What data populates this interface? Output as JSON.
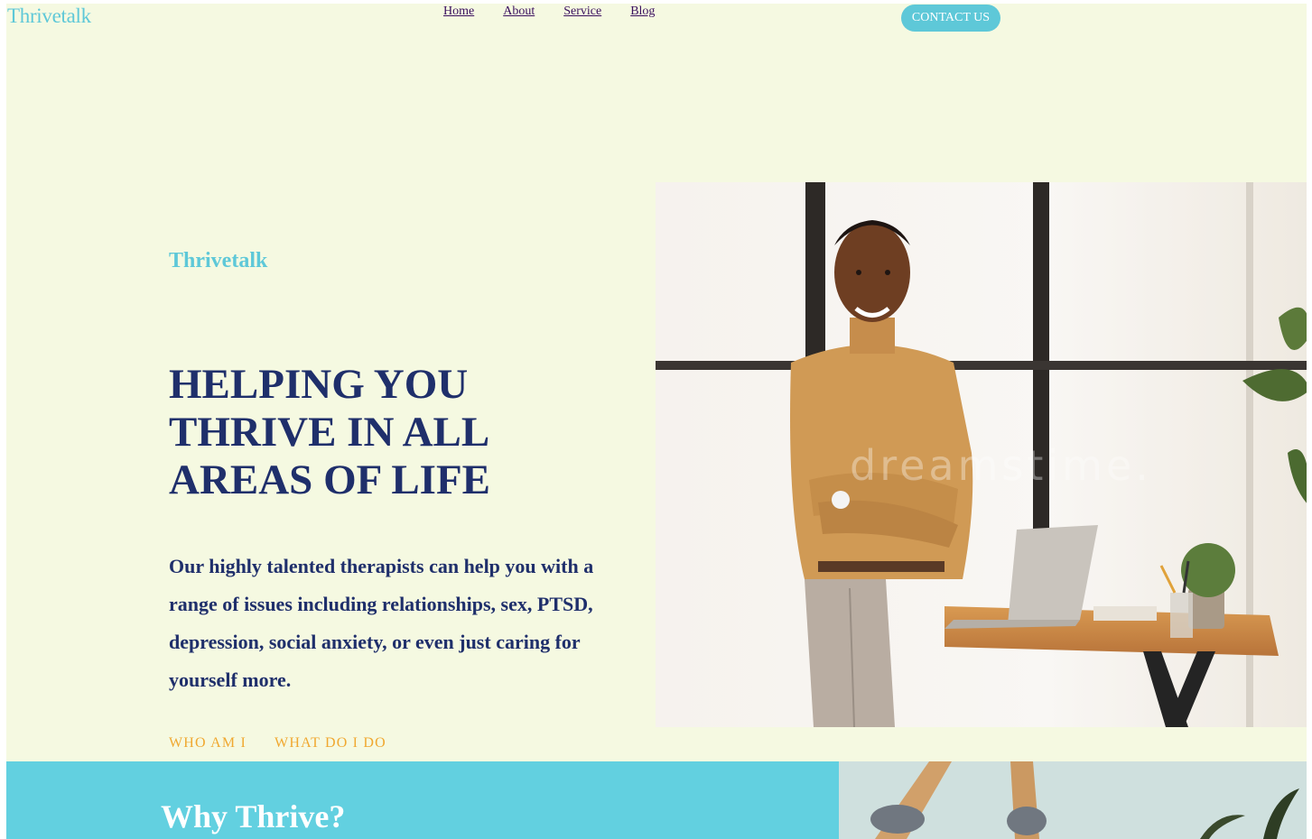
{
  "header": {
    "brand": "Thrivetalk",
    "nav": [
      "Home",
      "About",
      "Service",
      "Blog"
    ],
    "contact_label": "CONTACT US"
  },
  "hero": {
    "subtitle": "Thrivetalk",
    "title_lines": [
      "HELPING YOU",
      "THRIVE IN ALL",
      "AREAS OF LIFE"
    ],
    "description": "Our highly talented therapists can help you with a range of issues including relationships, sex, PTSD, depression, social anxiety, or even just caring for yourself more.",
    "links": [
      "WHO AM I",
      "WHAT DO I DO"
    ]
  },
  "why": {
    "title": "Why Thrive?"
  },
  "colors": {
    "background": "#f5f9e1",
    "accent": "#5ec8d8",
    "navy": "#1f2f6b",
    "orange": "#f0a830",
    "band": "#62d0e0"
  }
}
